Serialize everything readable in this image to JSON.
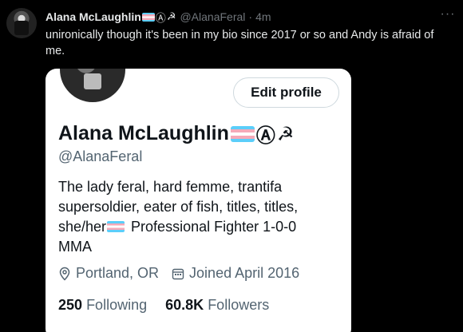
{
  "tweet": {
    "display_name": "Alana McLaughlin",
    "name_symbols": [
      "trans-flag-emoji",
      "Ⓐ",
      "☭"
    ],
    "handle": "@AlanaFeral",
    "separator": "·",
    "time": "4m",
    "more_icon": "···",
    "text": "unironically though it's been in my bio since 2017 or so and Andy is afraid of me."
  },
  "profile_card": {
    "edit_button": "Edit profile",
    "name": "Alana McLaughlin",
    "handle": "@AlanaFeral",
    "bio_part1": "The lady feral, hard femme, trantifa supersoldier, eater of fish, titles, titles, she/her",
    "bio_part2": " Professional Fighter 1-0-0 MMA",
    "location": "Portland, OR",
    "joined": "Joined April 2016",
    "following_count": "250",
    "following_label": "Following",
    "followers_count": "60.8K",
    "followers_label": "Followers"
  },
  "colors": {
    "background": "#000000",
    "text_primary": "#e7e9ea",
    "text_secondary": "#71767b",
    "card_bg": "#ffffff",
    "card_text": "#0f1419",
    "card_muted": "#536471",
    "trans_blue": "#5bcefa",
    "trans_pink": "#f5a9b8"
  }
}
